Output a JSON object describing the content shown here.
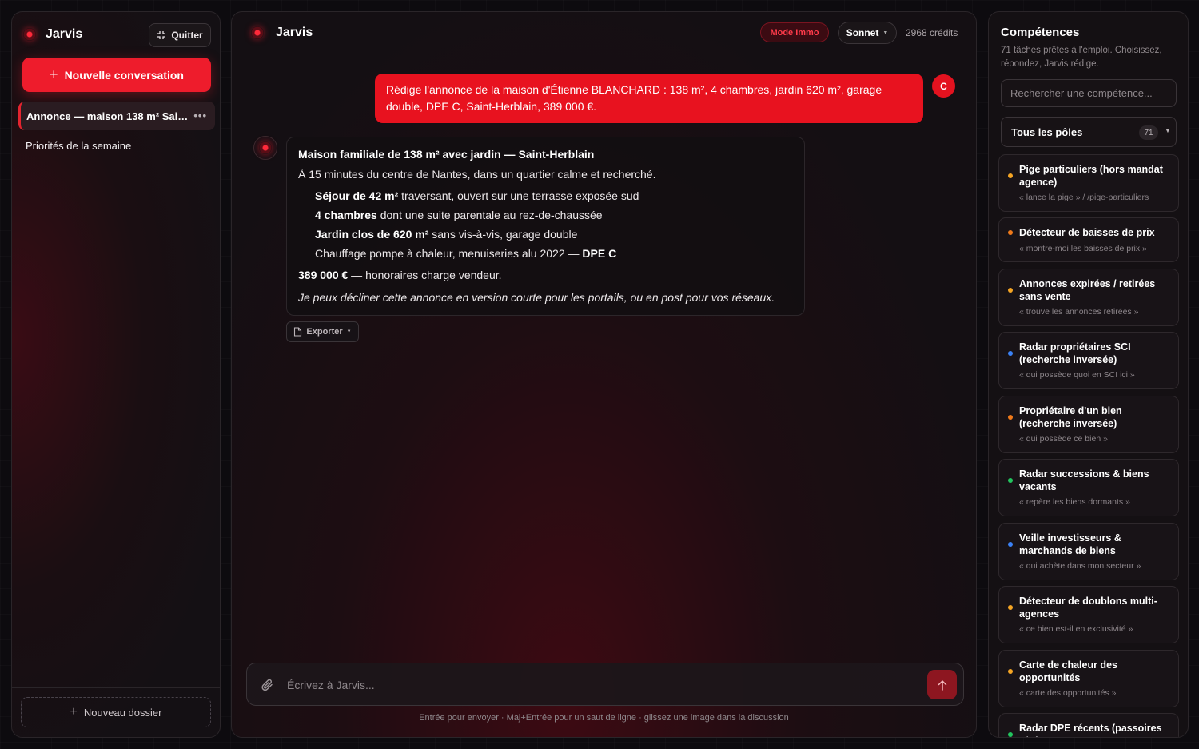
{
  "sidebar": {
    "brand": "Jarvis",
    "quit_label": "Quitter",
    "new_conversation_label": "Nouvelle conversation",
    "conversations": [
      {
        "label": "Annonce — maison 138 m² Sai…",
        "active": true,
        "menu": "•••"
      },
      {
        "label": "Priorités de la semaine",
        "active": false
      }
    ],
    "new_folder_label": "Nouveau dossier"
  },
  "header": {
    "title": "Jarvis",
    "mode_badge": "Mode Immo",
    "model": "Sonnet",
    "credits": "2968 crédits"
  },
  "chat": {
    "user_avatar": "C",
    "user_message": "Rédige l'annonce de la maison d'Étienne BLANCHARD : 138 m², 4 chambres, jardin 620 m², garage double, DPE C, Saint-Herblain, 389 000 €.",
    "assistant": {
      "title": "Maison familiale de 138 m² avec jardin — Saint-Herblain",
      "intro": "À 15 minutes du centre de Nantes, dans un quartier calme et recherché.",
      "bullets": [
        {
          "bold": "Séjour de 42 m²",
          "text": " traversant, ouvert sur une terrasse exposée sud",
          "tail_bold": ""
        },
        {
          "bold": "4 chambres",
          "text": " dont une suite parentale au rez-de-chaussée",
          "tail_bold": ""
        },
        {
          "bold": "Jardin clos de 620 m²",
          "text": " sans vis-à-vis, garage double",
          "tail_bold": ""
        },
        {
          "bold": "",
          "text": "Chauffage pompe à chaleur, menuiseries alu 2022 — ",
          "tail_bold": "DPE C"
        }
      ],
      "price_bold": "389 000 €",
      "price_text": " — honoraires charge vendeur.",
      "closing": "Je peux décliner cette annonce en version courte pour les portails, ou en post pour vos réseaux."
    },
    "export_label": "Exporter"
  },
  "composer": {
    "placeholder": "Écrivez à Jarvis...",
    "hint": "Entrée pour envoyer · Maj+Entrée pour un saut de ligne · glissez une image dans la discussion"
  },
  "skills": {
    "title": "Compétences",
    "subtitle": "71 tâches prêtes à l'emploi. Choisissez, répondez, Jarvis rédige.",
    "search_placeholder": "Rechercher une compétence...",
    "filter_label": "Tous les pôles",
    "count": "71",
    "items": [
      {
        "title": "Pige particuliers (hors mandat agence)",
        "hint": "« lance la pige » / /pige-particuliers",
        "color": "#f5a524"
      },
      {
        "title": "Détecteur de baisses de prix",
        "hint": "« montre-moi les baisses de prix »",
        "color": "#f07a1a"
      },
      {
        "title": "Annonces expirées / retirées sans vente",
        "hint": "« trouve les annonces retirées »",
        "color": "#f5a524"
      },
      {
        "title": "Radar propriétaires SCI (recherche inversée)",
        "hint": "« qui possède quoi en SCI ici »",
        "color": "#3b82f6"
      },
      {
        "title": "Propriétaire d'un bien (recherche inversée)",
        "hint": "« qui possède ce bien »",
        "color": "#f07a1a"
      },
      {
        "title": "Radar successions & biens vacants",
        "hint": "« repère les biens dormants »",
        "color": "#22c55e"
      },
      {
        "title": "Veille investisseurs & marchands de biens",
        "hint": "« qui achète dans mon secteur »",
        "color": "#3b82f6"
      },
      {
        "title": "Détecteur de doublons multi-agences",
        "hint": "« ce bien est-il en exclusivité »",
        "color": "#f5a524"
      },
      {
        "title": "Carte de chaleur des opportunités",
        "hint": "« carte des opportunités »",
        "color": "#f5a524"
      },
      {
        "title": "Radar DPE récents (passoires F/G)",
        "hint": "",
        "color": "#22c55e"
      }
    ]
  }
}
